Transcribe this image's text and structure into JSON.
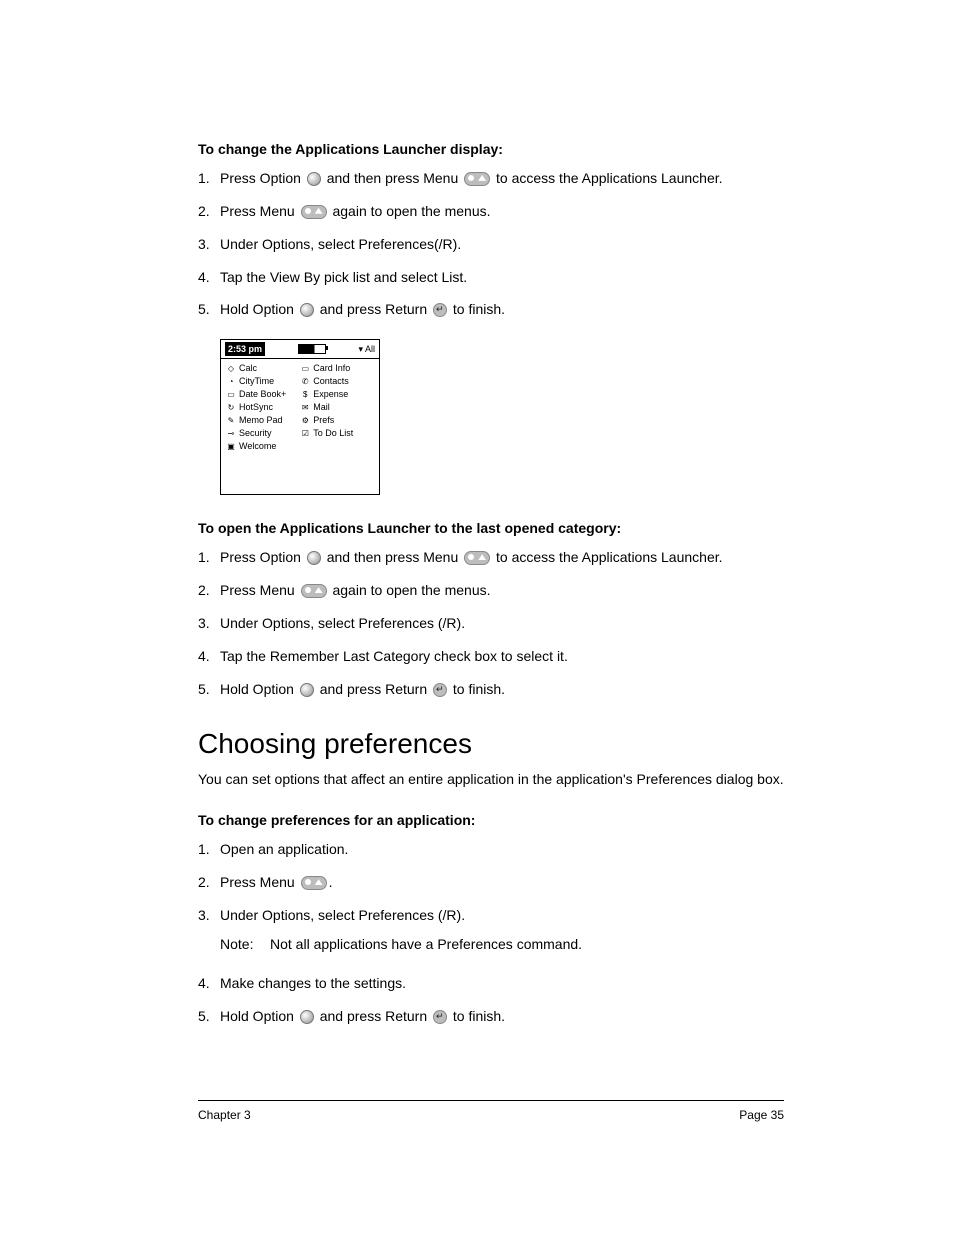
{
  "section1": {
    "title": "To change the Applications Launcher display:",
    "steps": [
      {
        "n": "1.",
        "pre": "Press Option ",
        "mid1": " and then press Menu ",
        "post": " to access the Applications Launcher."
      },
      {
        "n": "2.",
        "pre": "Press Menu ",
        "post": " again to open the menus."
      },
      {
        "n": "3.",
        "text": "Under Options, select Preferences(/R)."
      },
      {
        "n": "4.",
        "text": "Tap the View By pick list and select List."
      },
      {
        "n": "5.",
        "pre": "Hold Option ",
        "mid1": " and press Return ",
        "post": " to finish."
      }
    ]
  },
  "fig": {
    "time": "2:53 pm",
    "all": "▾ All",
    "col1": [
      {
        "ic": "◇",
        "t": "Calc"
      },
      {
        "ic": "◔",
        "t": "CityTime"
      },
      {
        "ic": "▭",
        "t": "Date Book+"
      },
      {
        "ic": "↻",
        "t": "HotSync"
      },
      {
        "ic": "✎",
        "t": "Memo Pad"
      },
      {
        "ic": "⊸",
        "t": "Security"
      },
      {
        "ic": "▣",
        "t": "Welcome"
      }
    ],
    "col2": [
      {
        "ic": "▭",
        "t": "Card Info"
      },
      {
        "ic": "✆",
        "t": "Contacts"
      },
      {
        "ic": "$",
        "t": "Expense"
      },
      {
        "ic": "✉",
        "t": "Mail"
      },
      {
        "ic": "⚙",
        "t": "Prefs"
      },
      {
        "ic": "☑",
        "t": "To Do List"
      }
    ]
  },
  "section2": {
    "title": "To open the Applications Launcher to the last opened category:",
    "steps": [
      {
        "n": "1.",
        "pre": "Press Option ",
        "mid1": " and then press Menu ",
        "post": " to access the Applications Launcher."
      },
      {
        "n": "2.",
        "pre": "Press Menu ",
        "post": " again to open the menus."
      },
      {
        "n": "3.",
        "text": "Under Options, select Preferences (/R)."
      },
      {
        "n": "4.",
        "text": "Tap the Remember Last Category check box to select it."
      },
      {
        "n": "5.",
        "pre": "Hold Option ",
        "mid1": " and press Return ",
        "post": " to finish."
      }
    ]
  },
  "heading": "Choosing preferences",
  "intro": "You can set options that affect an entire application in the application's Preferences dialog box.",
  "section3": {
    "title": "To change preferences for an application:",
    "steps": [
      {
        "n": "1.",
        "text": "Open an application."
      },
      {
        "n": "2.",
        "pre": "Press Menu ",
        "post": "."
      },
      {
        "n": "3.",
        "text": "Under Options, select Preferences (/R).",
        "note_label": "Note:",
        "note": "Not all applications have a Preferences command."
      },
      {
        "n": "4.",
        "text": "Make changes to the settings."
      },
      {
        "n": "5.",
        "pre": "Hold Option ",
        "mid1": " and press Return ",
        "post": " to finish."
      }
    ]
  },
  "footer": {
    "left": "Chapter 3",
    "right": "Page 35"
  }
}
